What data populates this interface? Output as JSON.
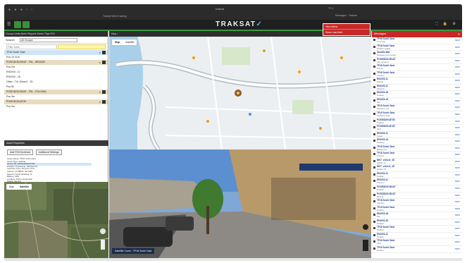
{
  "browser": {
    "url": "traksat",
    "tab_title": "Traksat Web Tracking",
    "tab_right": "Messages · Traksat",
    "window_label": "TP-1"
  },
  "app": {
    "logo": "TRAKSAT",
    "icons": [
      "menu-icon",
      "map-icon",
      "settings-icon",
      "fullscreen-icon",
      "user-icon"
    ]
  },
  "popup": {
    "items": [
      "View Alerts",
      "Show Last Alert"
    ]
  },
  "left_panel": {
    "tabs": "Groups  Units  Alerts  Reports  Zones  Trips  POI",
    "group_label": "Search",
    "group_value": "All Groups",
    "search_placeholder": "Filter Units",
    "vehicles": [
      {
        "label": "TP16 Sochi Gast",
        "style": "blue"
      },
      {
        "label": "Pos 1h 21m",
        "style": "plain"
      },
      {
        "label": "POSEIDON BOAT - FSL - 8534000",
        "style": "tan"
      },
      {
        "label": "Pos 2m",
        "style": "plain"
      },
      {
        "label": "EN1003 - 11",
        "style": "plain"
      },
      {
        "label": "EN1003 - 18",
        "style": "plain"
      },
      {
        "label": "Other - Thr. Driver2 - 1D",
        "style": "plain"
      },
      {
        "label": "Pos 5h",
        "style": "plain"
      },
      {
        "label": "POSEIDON BOAT - FSL - POLONIA",
        "style": "tan"
      },
      {
        "label": "Pos 3m",
        "style": "plain"
      },
      {
        "label": "POSEIDON-BT30",
        "style": "tan"
      },
      {
        "label": "Pos 3m",
        "style": "plain"
      }
    ],
    "section_title": "Asset Properties",
    "buttons": [
      "Add POI/Geofence",
      "Additional Settings"
    ],
    "properties": [
      "Asset Name: TP16 Sochi Gast",
      "Asset Type: Vehicle",
      "Device ID: 300434063117250",
      "Position Timestamp: 2018-03-15",
      "Last Pos Time: 10:11:27 UTC",
      "Lat/Lon: 43.5869 / 39.7229",
      "Speed: 0 km/h  Heading: N",
      "Battery: 92%",
      "Location: Sochi, Krasnodar",
      "Status: Moving",
      "Driver: Unassigned",
      "Group: Demo",
      "Ignition: On",
      "Odometer: 12350 km",
      "Fuel: 68%",
      "Temp: 21 C"
    ],
    "minimap_tabs": [
      "Map",
      "Satellite"
    ]
  },
  "center": {
    "bar_title": "Map",
    "map_tabs": [
      "Map",
      "Satellite"
    ],
    "street_caption": "Satellite Cover - TP16 Sochi Gast"
  },
  "messages": {
    "title": "Messages",
    "items": [
      {
        "t1": "TP16 Sochi Gast",
        "t2": "5 min ago"
      },
      {
        "t1": "TP16 Sochi Gast",
        "t2": "Position update"
      },
      {
        "t1": "Sandlfo Bak",
        "t2": "Message text preview"
      },
      {
        "t1": "POSEIDON BOAT",
        "t2": "FSL received"
      },
      {
        "t1": "TP16 Sochi Gast",
        "t2": "Pos ok"
      },
      {
        "t1": "TP16 Sochi Gast",
        "t2": "Check in"
      },
      {
        "t1": "EN1003-11",
        "t2": "Moving"
      },
      {
        "t1": "EN1003-11",
        "t2": "Stopped"
      },
      {
        "t1": "EN1003-18",
        "t2": "Position"
      },
      {
        "t1": "EN1003-18",
        "t2": "Idle"
      },
      {
        "t1": "TP16 Sochi Gast",
        "t2": "Geofence exit"
      },
      {
        "t1": "TP16 Sochi Gast",
        "t2": "Geofence enter"
      },
      {
        "t1": "POSEIDON-BT30",
        "t2": "Position"
      },
      {
        "t1": "POSEIDON-BT30",
        "t2": "Alert"
      },
      {
        "t1": "EN1003-11",
        "t2": "Speed"
      },
      {
        "t1": "EN1003-18",
        "t2": "Heading"
      },
      {
        "t1": "TP16 Sochi Gast",
        "t2": "Battery low"
      },
      {
        "t1": "TP16 Sochi Gast",
        "t2": "Position"
      },
      {
        "t1": "MKT_vehicle_48",
        "t2": "Ignition on"
      },
      {
        "t1": "MKT_vehicle_48",
        "t2": "Ignition off"
      },
      {
        "t1": "EN1003-11",
        "t2": "Position"
      },
      {
        "t1": "EN1003-11",
        "t2": "Check in"
      },
      {
        "t1": "POSEIDON BOAT",
        "t2": "Position"
      },
      {
        "t1": "POSEIDON BOAT",
        "t2": "Moving"
      },
      {
        "t1": "TP16 Sochi Gast",
        "t2": "Stopped"
      },
      {
        "t1": "TP16 Sochi Gast",
        "t2": "Position"
      },
      {
        "t1": "EN1003-18",
        "t2": "Idle"
      },
      {
        "t1": "EN1003-18",
        "t2": "Position"
      },
      {
        "t1": "TP16 Sochi Gast",
        "t2": "Position"
      },
      {
        "t1": "EN1003-11",
        "t2": "Position"
      },
      {
        "t1": "TP16 Sochi Gast",
        "t2": "Alert"
      },
      {
        "t1": "TP16 Sochi Gast",
        "t2": "Position"
      }
    ],
    "link_label": "more"
  },
  "colors": {
    "accent_green": "#3a9d3a",
    "alert_red": "#c62828",
    "header_dark": "#1f1f1f",
    "logo_blue": "#5bb7d6"
  }
}
